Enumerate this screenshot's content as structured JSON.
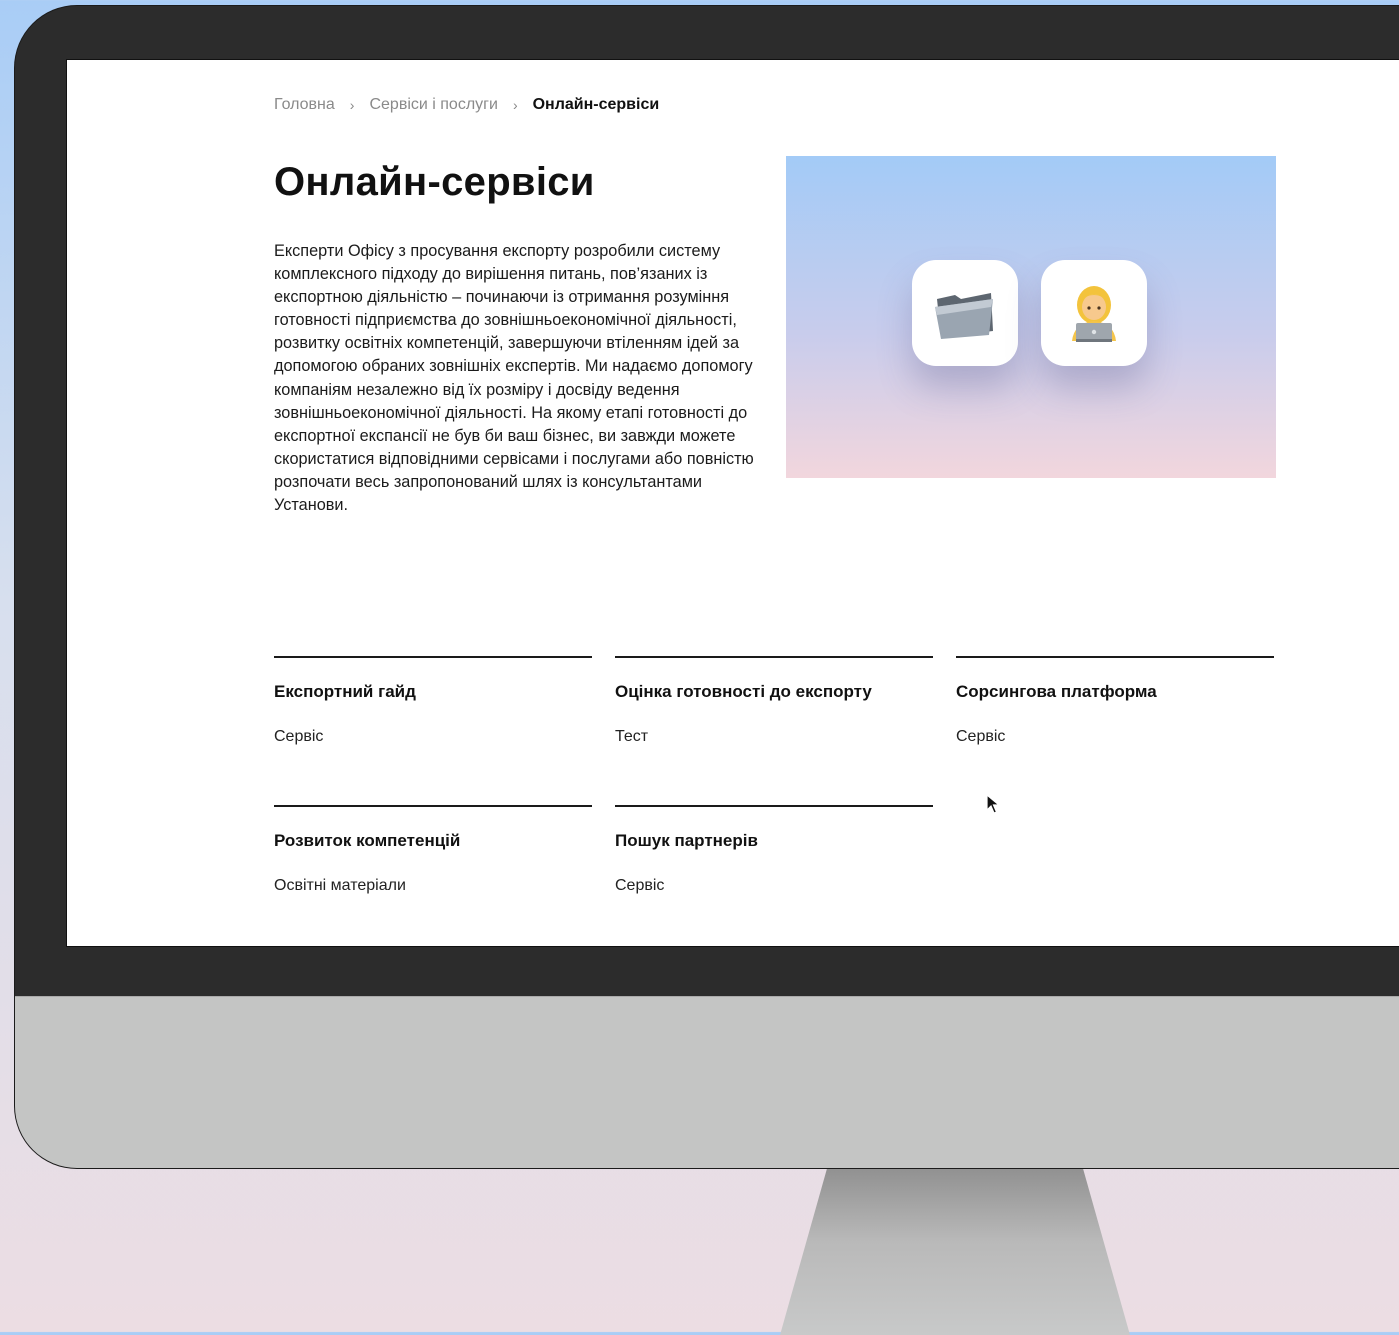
{
  "breadcrumb": {
    "home": "Головна",
    "services": "Сервіси і послуги",
    "current": "Онлайн-сервіси"
  },
  "page": {
    "title": "Онлайн-сервіси",
    "intro": "Експерти Офісу з просування експорту розробили систему комплексного підходу до вирішення питань, пов’язаних із експортною діяльністю – починаючи із отримання розуміння готовності підприємства до зовнішньоекономічної діяльності, розвитку освітніх компетенцій, завершуючи втіленням ідей за допомогою обраних зовнішніх експертів. Ми надаємо допомогу компаніям незалежно від їх розміру і досвіду ведення зовнішньоекономічної діяльності. На якому етапі готовності до експортної експансії не був би ваш бізнес, ви завжди можете скористатися відповідними сервісами і послугами або повністю розпочати весь запропонований шлях із консультантами Установи."
  },
  "hero": {
    "icons": [
      "folder-icon",
      "person-with-laptop-icon"
    ],
    "colors": {
      "top": "#a3cbf7",
      "bottom": "#f2d6dd"
    }
  },
  "services": [
    {
      "title": "Експортний гайд",
      "type": "Сервіс"
    },
    {
      "title": "Оцінка готовності до експорту",
      "type": "Тест"
    },
    {
      "title": "Сорсингова платформа",
      "type": "Сервіс"
    },
    {
      "title": "Розвиток компетенцій",
      "type": "Освітні матеріали"
    },
    {
      "title": "Пошук партнерів",
      "type": "Сервіс"
    }
  ],
  "colors": {
    "background_top": "#a9cdf6",
    "background_bottom": "#ecdde3",
    "bezel": "#2c2c2c",
    "chin": "#c4c5c4",
    "text": "#111111"
  }
}
